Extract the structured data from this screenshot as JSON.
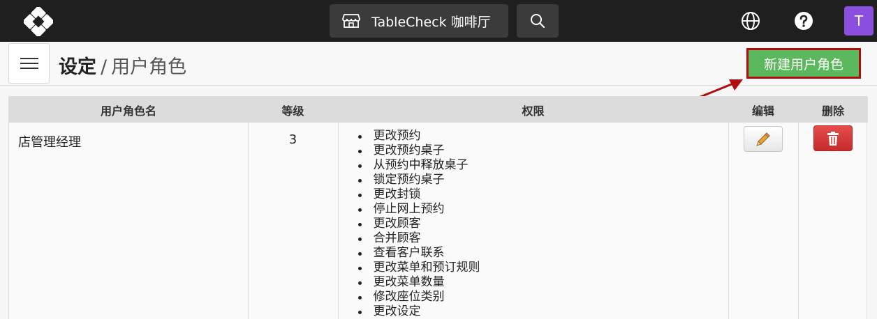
{
  "topbar": {
    "venue_name": "TableCheck 咖啡厅",
    "avatar_initial": "T",
    "avatar_color": "#8b4fe0",
    "icons": [
      "logo-icon",
      "store-icon",
      "search-icon",
      "globe-icon",
      "help-icon"
    ]
  },
  "header": {
    "title": "设定",
    "separator": "/",
    "subtitle": "用户角色",
    "new_role_button": "新建用户角色",
    "accent_color": "#5cb85c",
    "highlight_color": "#b20b0b"
  },
  "table": {
    "columns": [
      "用户角色名",
      "等级",
      "权限",
      "编辑",
      "删除"
    ],
    "rows": [
      {
        "name": "店管理经理",
        "level": "3",
        "permissions": [
          "更改预约",
          "更改预约桌子",
          "从预约中释放桌子",
          "锁定预约桌子",
          "更改封锁",
          "停止网上预约",
          "更改顾客",
          "合并顾客",
          "查看客户联系",
          "更改菜单和预订规则",
          "更改菜单数量",
          "修改座位类别",
          "更改设定"
        ]
      }
    ]
  }
}
